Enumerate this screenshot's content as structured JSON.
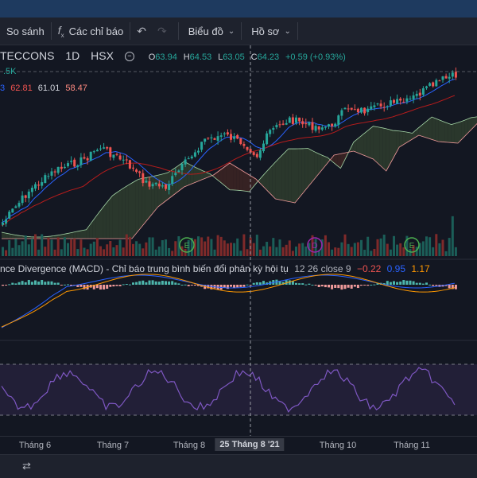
{
  "toolbar": {
    "compare_label": "So sánh",
    "indicators_label": "Các chỉ báo",
    "chart_type_label": "Biểu đồ",
    "profile_label": "Hồ sơ"
  },
  "symbol": {
    "name": "TECCONS",
    "interval": "1D",
    "exchange": "HSX",
    "open_label": "O",
    "open": "63.94",
    "high_label": "H",
    "high": "64.53",
    "low_label": "L",
    "low": "63.05",
    "close_label": "C",
    "close": "64.23",
    "change": "+0.59 (+0.93%)"
  },
  "volume_label": ".5K",
  "ichimoku": {
    "v1": "3",
    "v2": "62.81",
    "v3": "61.01",
    "v4": "58.47"
  },
  "macd": {
    "title": "nce Divergence (MACD) - Chỉ báo trung bình biến đổi phân kỳ hội tụ",
    "params": "12 26 close 9",
    "v1": "−0.22",
    "v2": "0.95",
    "v3": "1.17"
  },
  "markers": [
    "E",
    "D",
    "E"
  ],
  "time_axis": {
    "labels": [
      "Tháng 6",
      "Tháng 7",
      "Tháng 8",
      "Tháng 10",
      "Tháng 11"
    ],
    "crosshair_label": "25 Tháng 8 '21"
  },
  "colors": {
    "up": "#26a69a",
    "down": "#ef5350",
    "macd_line": "#2962ff",
    "signal_line": "#ff9800",
    "rsi_line": "#7e57c2",
    "cloud_bull": "#2e3b2e",
    "cloud_bear": "#3b2424"
  }
}
